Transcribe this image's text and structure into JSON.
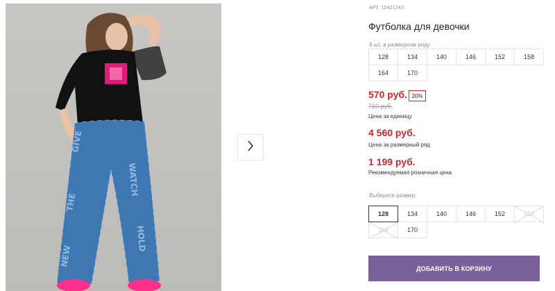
{
  "product": {
    "article": "АРТ. 12421243",
    "title": "Футболка для девочки",
    "pieces_in_row": "8 шт. в размерном ряду"
  },
  "size_row": [
    "128",
    "134",
    "140",
    "146",
    "152",
    "158",
    "164",
    "170"
  ],
  "pricing": {
    "unit_price": "570 руб.",
    "discount": "20%",
    "old_price": "710 руб.",
    "unit_label": "Цена за единицу",
    "row_price": "4 560 руб.",
    "row_label": "Цена за размерный ряд",
    "retail_price": "1 199 руб.",
    "retail_label": "Рекомендуемая розничная цена"
  },
  "size_picker": {
    "label": "Выберите размер:",
    "options": [
      {
        "value": "128",
        "state": "selected"
      },
      {
        "value": "134",
        "state": "available"
      },
      {
        "value": "140",
        "state": "available"
      },
      {
        "value": "146",
        "state": "available"
      },
      {
        "value": "152",
        "state": "available"
      },
      {
        "value": "158",
        "state": "unavailable"
      },
      {
        "value": "164",
        "state": "unavailable"
      },
      {
        "value": "170",
        "state": "available"
      }
    ]
  },
  "cart_button": "ДОБАВИТЬ В КОРЗИНУ",
  "icons": {
    "next": "chevron-right-icon"
  },
  "colors": {
    "accent": "#7b619a",
    "price": "#d2232a"
  }
}
